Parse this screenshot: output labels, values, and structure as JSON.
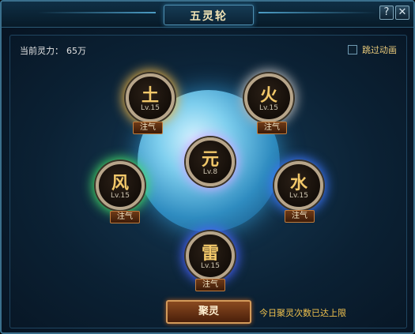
{
  "window": {
    "title": "五灵轮",
    "help_label": "?",
    "close_label": "✕"
  },
  "status": {
    "power_label": "当前灵力：",
    "power_value": "65万"
  },
  "options": {
    "skip_animation_label": "跳过动画",
    "skip_animation_checked": false
  },
  "elements": [
    {
      "key": "earth",
      "glyph": "土",
      "level": "Lv.15",
      "action": "注气",
      "glow": "#e6b24a"
    },
    {
      "key": "fire",
      "glyph": "火",
      "level": "Lv.15",
      "action": "注气",
      "glow": "#b6b6b6"
    },
    {
      "key": "core",
      "glyph": "元",
      "level": "Lv.8"
    },
    {
      "key": "wind",
      "glyph": "风",
      "level": "Lv.15",
      "action": "注气",
      "glow": "#46e06a"
    },
    {
      "key": "water",
      "glyph": "水",
      "level": "Lv.15",
      "action": "注气",
      "glow": "#3d78ff"
    },
    {
      "key": "thunder",
      "glyph": "雷",
      "level": "Lv.15",
      "action": "注气",
      "glow": "#4a64ff"
    }
  ],
  "footer": {
    "gather_label": "聚灵",
    "limit_text": "今日聚灵次数已达上限"
  },
  "colors": {
    "accent": "#f2c86a",
    "orb": "#7fcfee",
    "warning": "#f1c24e"
  }
}
